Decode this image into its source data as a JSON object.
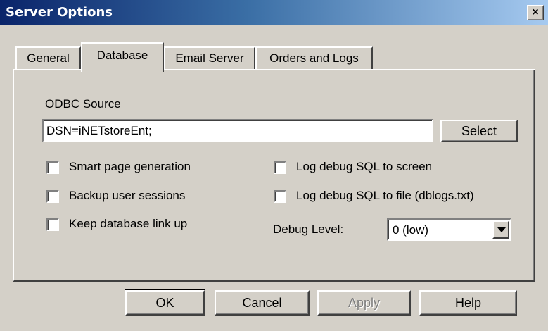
{
  "window": {
    "title": "Server Options",
    "close_glyph": "×"
  },
  "tabs": [
    {
      "label": "General",
      "active": false
    },
    {
      "label": "Database",
      "active": true
    },
    {
      "label": "Email Server",
      "active": false
    },
    {
      "label": "Orders and Logs",
      "active": false
    }
  ],
  "database": {
    "odbc_label": "ODBC Source",
    "odbc_value": "DSN=iNETstoreEnt;",
    "select_label": "Select",
    "checkboxes": {
      "smart_page": {
        "label": "Smart page generation",
        "checked": false
      },
      "backup_sessions": {
        "label": "Backup user sessions",
        "checked": false
      },
      "keep_link": {
        "label": "Keep database link up",
        "checked": false
      },
      "log_screen": {
        "label": "Log debug SQL to screen",
        "checked": false
      },
      "log_file": {
        "label": "Log debug SQL to file (dblogs.txt)",
        "checked": false
      }
    },
    "debug_level_label": "Debug Level:",
    "debug_level_value": "0 (low)"
  },
  "buttons": {
    "ok": "OK",
    "cancel": "Cancel",
    "apply": "Apply",
    "help": "Help"
  },
  "colors": {
    "face": "#d4d0c8",
    "titlebar_start": "#0a246a",
    "titlebar_end": "#a6caf0"
  }
}
